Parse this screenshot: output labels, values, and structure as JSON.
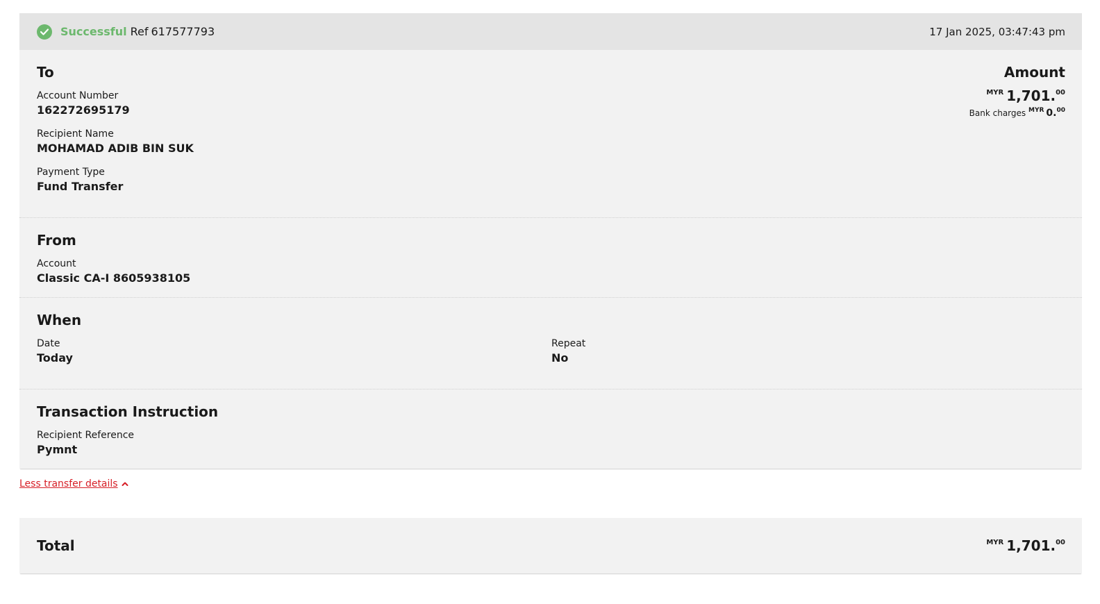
{
  "status": {
    "label": "Successful",
    "ref_label": "Ref",
    "ref_number": "617577793",
    "timestamp": "17 Jan 2025, 03:47:43 pm",
    "color": "#6cb86d"
  },
  "to": {
    "title": "To",
    "account_number_label": "Account Number",
    "account_number": "162272695179",
    "recipient_name_label": "Recipient Name",
    "recipient_name": "MOHAMAD ADIB BIN SUK",
    "payment_type_label": "Payment Type",
    "payment_type": "Fund Transfer"
  },
  "amount": {
    "title": "Amount",
    "currency": "MYR",
    "whole": "1,701.",
    "decimal": "00",
    "bank_charges_label": "Bank charges",
    "charges_currency": "MYR",
    "charges_whole": "0.",
    "charges_decimal": "00"
  },
  "from": {
    "title": "From",
    "account_label": "Account",
    "account": "Classic CA-I 8605938105"
  },
  "when": {
    "title": "When",
    "date_label": "Date",
    "date": "Today",
    "repeat_label": "Repeat",
    "repeat": "No"
  },
  "instruction": {
    "title": "Transaction Instruction",
    "recipient_reference_label": "Recipient Reference",
    "recipient_reference": "Pymnt"
  },
  "toggle": {
    "label": "Less transfer details",
    "color": "#d71f27"
  },
  "total": {
    "title": "Total",
    "currency": "MYR",
    "whole": "1,701.",
    "decimal": "00"
  }
}
